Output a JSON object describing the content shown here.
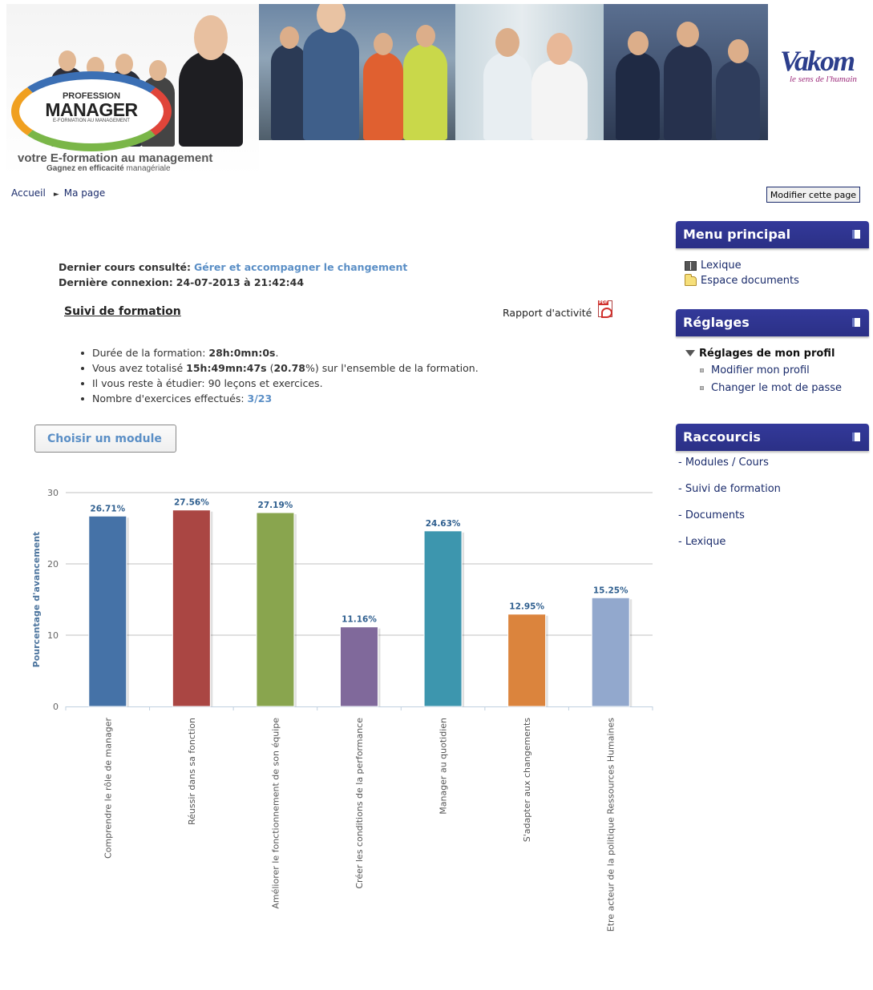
{
  "header": {
    "logo_small": "PROFESSION",
    "logo_big": "MANAGER",
    "logo_tiny": "E-FORMATION AU MANAGEMENT",
    "tagline": "votre E-formation au management",
    "subtagline_bold": "Gagnez en efficacité",
    "subtagline_rest": "managériale",
    "partner_logo": "Vakom",
    "partner_slogan": "le sens de l'humain"
  },
  "breadcrumb": {
    "home": "Accueil",
    "separator": "►",
    "current": "Ma page"
  },
  "edit_button": "Modifier cette page",
  "info": {
    "last_course_label": "Dernier cours consulté:",
    "last_course_value": "Gérer et accompagner le changement",
    "last_login_label": "Dernière connexion:",
    "last_login_value": "24-07-2013 à 21:42:44"
  },
  "suivi": {
    "title": "Suivi de formation",
    "report_label": "Rapport d'activité",
    "report_icon": "pdf-icon"
  },
  "stats": {
    "duration_label": "Durée de la formation: ",
    "duration_value": "28h:0mn:0s",
    "duration_end": ".",
    "total_label": "Vous avez totalisé ",
    "total_value": "15h:49mn:47s",
    "total_pct_open": " (",
    "total_pct": "20.78",
    "total_rest": "%) sur l'ensemble de la formation.",
    "remaining": "Il vous reste à étudier: 90 leçons et exercices.",
    "exercises_label": "Nombre d'exercices effectués: ",
    "exercises_value": "3/23"
  },
  "module_button": "Choisir un module",
  "chart_data": {
    "type": "bar",
    "ylabel": "Pourcentage d'avancement",
    "ylim": [
      0,
      30
    ],
    "yticks": [
      0,
      10,
      20,
      30
    ],
    "grid": true,
    "categories": [
      "Comprendre le rôle de manager",
      "Réussir dans sa fonction",
      "Améliorer le fonctionnement de son équipe",
      "Créer les conditions de la performance",
      "Manager au quotidien",
      "S'adapter aux changements",
      "Etre acteur de la politique Ressources Humaines"
    ],
    "values": [
      26.71,
      27.56,
      27.19,
      11.16,
      24.63,
      12.95,
      15.25
    ],
    "labels": [
      "26.71%",
      "27.56%",
      "27.19%",
      "11.16%",
      "24.63%",
      "12.95%",
      "15.25%"
    ],
    "colors": [
      "#4572a7",
      "#aa4643",
      "#89a54e",
      "#80699b",
      "#3d96ae",
      "#db843d",
      "#92a8cd"
    ]
  },
  "sidebar": {
    "menu": {
      "title": "Menu principal",
      "items": [
        {
          "label": "Lexique",
          "icon": "book-icon"
        },
        {
          "label": "Espace documents",
          "icon": "folder-icon"
        }
      ]
    },
    "settings": {
      "title": "Réglages",
      "section": "Réglages de mon profil",
      "items": [
        "Modifier mon profil",
        "Changer le mot de passe"
      ]
    },
    "shortcuts": {
      "title": "Raccourcis",
      "items": [
        "- Modules / Cours",
        "- Suivi de formation",
        "- Documents",
        "- Lexique"
      ]
    }
  }
}
